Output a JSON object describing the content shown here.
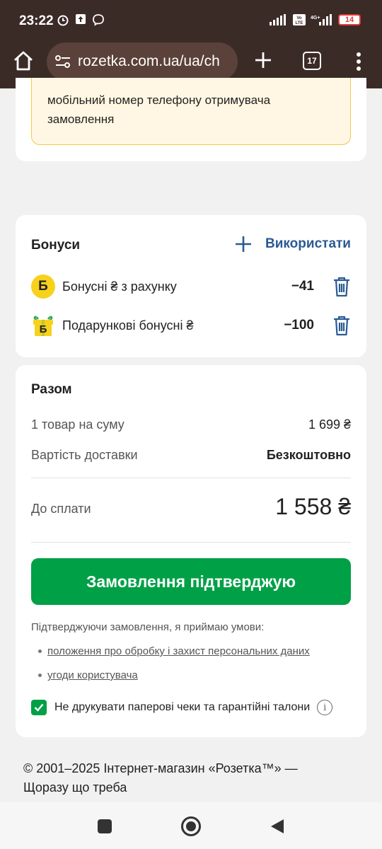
{
  "status_bar": {
    "time": "23:22",
    "battery": "14"
  },
  "browser": {
    "url": "rozetka.com.ua/ua/ch",
    "tab_count": "17"
  },
  "notice": {
    "text": "мобільний номер телефону отримувача замовлення"
  },
  "bonuses": {
    "title": "Бонуси",
    "use_label": "Використати",
    "items": [
      {
        "icon_letter": "Б",
        "label": "Бонусні ₴ з рахунку",
        "amount": "−41"
      },
      {
        "icon_letter": "Б",
        "label": "Подарункові бонусні ₴",
        "amount": "−100"
      }
    ]
  },
  "total": {
    "title": "Разом",
    "items_label": "1 товар на суму",
    "items_value": "1 699 ₴",
    "delivery_label": "Вартість доставки",
    "delivery_value": "Безкоштовно",
    "pay_label": "До сплати",
    "pay_value": "1 558 ₴",
    "confirm_button": "Замовлення підтверджую",
    "terms_intro": "Підтверджуючи замовлення, я приймаю умови:",
    "terms": [
      "положення про обробку і захист персональних даних",
      "угоди користувача"
    ],
    "paper_checkbox_label": "Не друкувати паперові чеки та гарантійні талони",
    "paper_checkbox_checked": true,
    "info_glyph": "i"
  },
  "footer": {
    "text": "© 2001–2025 Інтернет-магазин «Розетка™» — Щоразу що треба"
  },
  "colors": {
    "accent_green": "#00a046",
    "link_blue": "#2a5a93",
    "coin_yellow": "#f7d11b",
    "browser_bar": "#3b2b26"
  }
}
